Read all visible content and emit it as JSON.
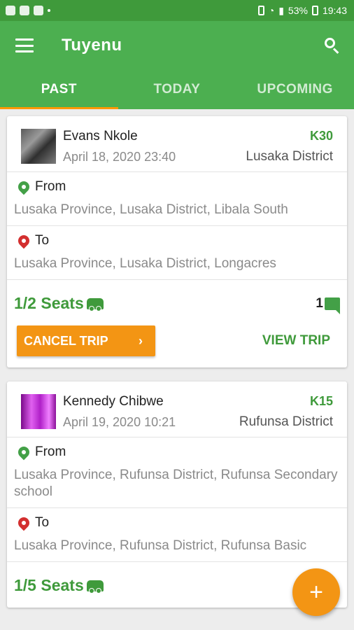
{
  "status_bar": {
    "battery": "53%",
    "time": "19:43"
  },
  "app": {
    "title": "Tuyenu"
  },
  "tabs": [
    {
      "label": "PAST",
      "active": true
    },
    {
      "label": "TODAY",
      "active": false
    },
    {
      "label": "UPCOMING",
      "active": false
    }
  ],
  "trips": [
    {
      "driver": "Evans Nkole",
      "date": "April 18, 2020 23:40",
      "price": "K30",
      "district": "Lusaka District",
      "from_label": "From",
      "from": "Lusaka Province, Lusaka District, Libala South",
      "to_label": "To",
      "to": "Lusaka Province, Lusaka District, Longacres",
      "seats": "1/2 Seats",
      "comments": "1",
      "cancel_label": "CANCEL TRIP",
      "view_label": "VIEW TRIP"
    },
    {
      "driver": "Kennedy  Chibwe",
      "date": "April 19, 2020 10:21",
      "price": "K15",
      "district": "Rufunsa District",
      "from_label": "From",
      "from": "Lusaka Province, Rufunsa District, Rufunsa Secondary school",
      "to_label": "To",
      "to": "Lusaka Province, Rufunsa District, Rufunsa Basic",
      "seats": "1/5 Seats"
    }
  ],
  "fab": {
    "label": "+"
  },
  "colors": {
    "primary": "#4caf50",
    "accent": "#f39514",
    "status_bar": "#3f9a3b"
  }
}
